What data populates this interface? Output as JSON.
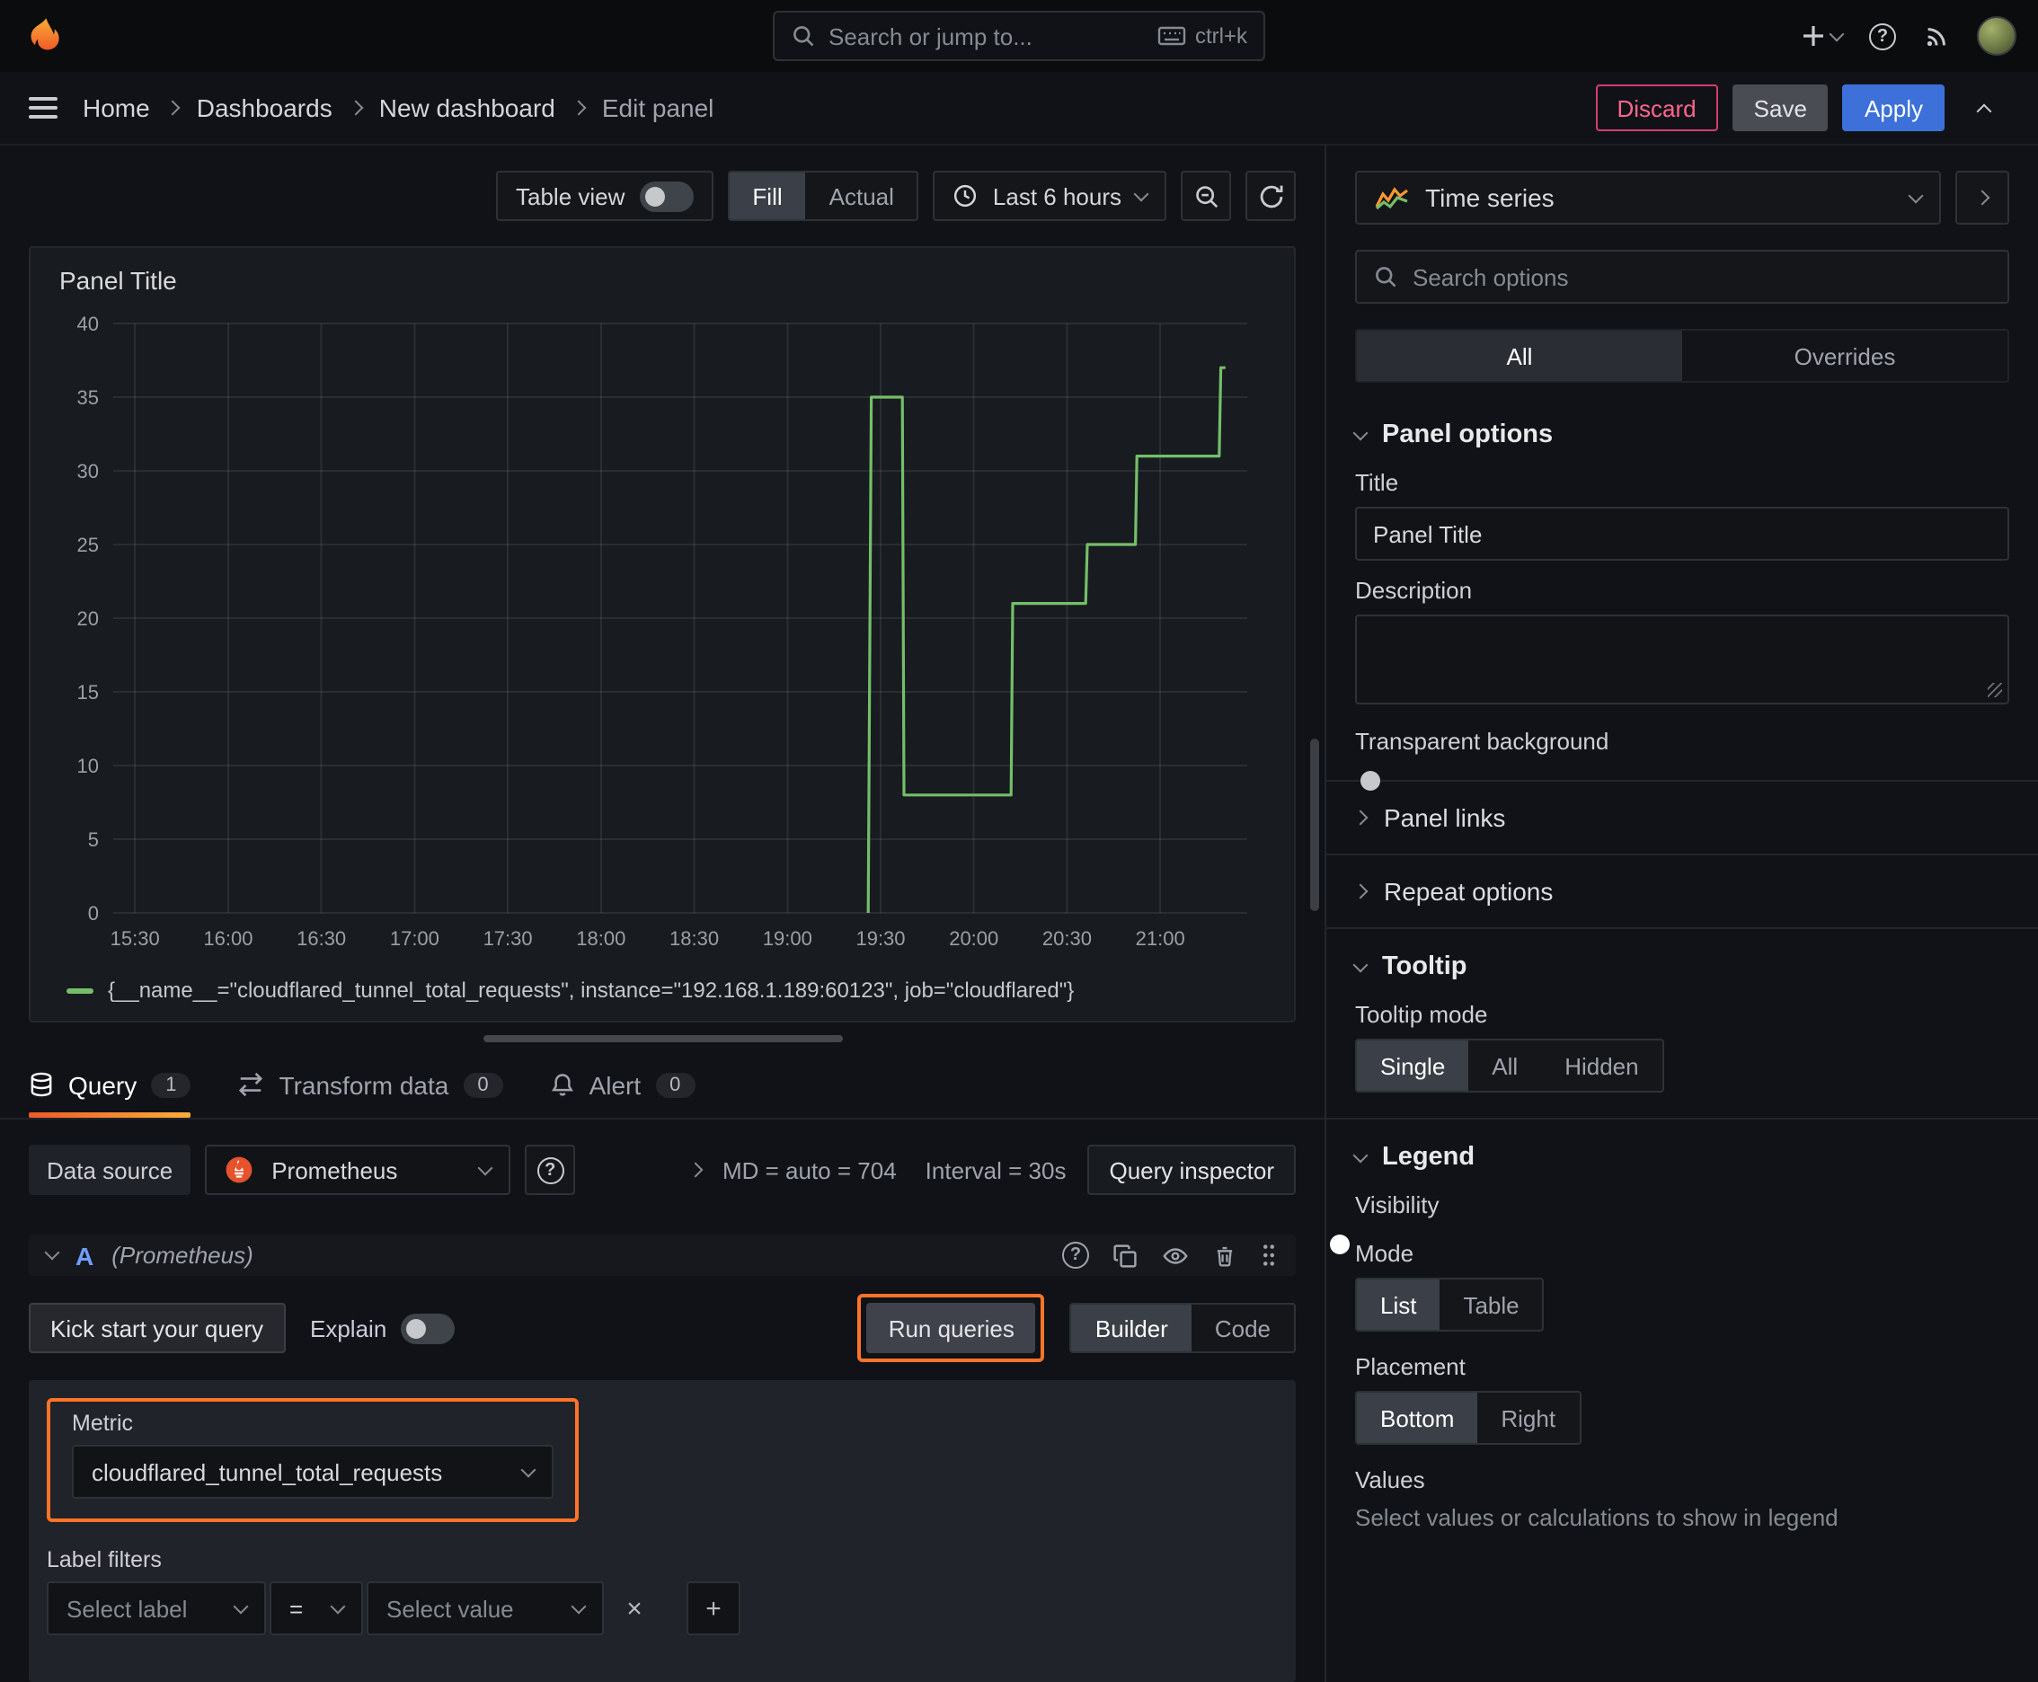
{
  "topnav": {
    "search_placeholder": "Search or jump to...",
    "shortcut": "ctrl+k"
  },
  "breadcrumb": {
    "items": [
      "Home",
      "Dashboards",
      "New dashboard",
      "Edit panel"
    ],
    "discard_label": "Discard",
    "save_label": "Save",
    "apply_label": "Apply"
  },
  "toolbar": {
    "table_view_label": "Table view",
    "fill_label": "Fill",
    "actual_label": "Actual",
    "time_range_label": "Last 6 hours"
  },
  "panel": {
    "title": "Panel Title"
  },
  "chart_data": {
    "type": "line",
    "title": "Panel Title",
    "x_unit": "minutes since 15:30",
    "x_ticks": [
      "15:30",
      "16:00",
      "16:30",
      "17:00",
      "17:30",
      "18:00",
      "18:30",
      "19:00",
      "19:30",
      "20:00",
      "20:30",
      "21:00"
    ],
    "x_tick_minutes": [
      0,
      30,
      60,
      90,
      120,
      150,
      180,
      210,
      240,
      270,
      300,
      330
    ],
    "xlim": [
      -7,
      358
    ],
    "ylim": [
      0,
      40
    ],
    "y_ticks": [
      0,
      5,
      10,
      15,
      20,
      25,
      30,
      35,
      40
    ],
    "grid": true,
    "legend_position": "bottom",
    "series": [
      {
        "name": "{__name__=\"cloudflared_tunnel_total_requests\", instance=\"192.168.1.189:60123\", job=\"cloudflared\"}",
        "color": "#73bf69",
        "points": [
          [
            236,
            0
          ],
          [
            237,
            35
          ],
          [
            247,
            35
          ],
          [
            247.5,
            8
          ],
          [
            282,
            8
          ],
          [
            282.5,
            21
          ],
          [
            306,
            21
          ],
          [
            306.5,
            25
          ],
          [
            322,
            25
          ],
          [
            322.5,
            31
          ],
          [
            349,
            31
          ],
          [
            349.5,
            37
          ],
          [
            351,
            37
          ]
        ]
      }
    ]
  },
  "tabs": [
    {
      "label": "Query",
      "badge": "1"
    },
    {
      "label": "Transform data",
      "badge": "0"
    },
    {
      "label": "Alert",
      "badge": "0"
    }
  ],
  "query": {
    "datasource_label": "Data source",
    "datasource_name": "Prometheus",
    "stats_md": "MD = auto = 704",
    "stats_interval": "Interval = 30s",
    "inspector_label": "Query inspector",
    "ref_id": "A",
    "ref_ds": "(Prometheus)",
    "kickstart_label": "Kick start your query",
    "explain_label": "Explain",
    "run_queries_label": "Run queries",
    "builder_label": "Builder",
    "code_label": "Code",
    "metric_label": "Metric",
    "metric_value": "cloudflared_tunnel_total_requests",
    "label_filters_label": "Label filters",
    "select_label_placeholder": "Select label",
    "operator_value": "=",
    "select_value_placeholder": "Select value"
  },
  "options": {
    "viz_label": "Time series",
    "search_placeholder": "Search options",
    "tab_all": "All",
    "tab_overrides": "Overrides",
    "panel_options_title": "Panel options",
    "title_label": "Title",
    "title_value": "Panel Title",
    "description_label": "Description",
    "transparent_label": "Transparent background",
    "panel_links_label": "Panel links",
    "repeat_options_label": "Repeat options",
    "tooltip_title": "Tooltip",
    "tooltip_mode_label": "Tooltip mode",
    "tooltip_modes": [
      "Single",
      "All",
      "Hidden"
    ],
    "legend_title": "Legend",
    "visibility_label": "Visibility",
    "mode_label": "Mode",
    "modes": [
      "List",
      "Table"
    ],
    "placement_label": "Placement",
    "placements": [
      "Bottom",
      "Right"
    ],
    "values_label": "Values",
    "values_desc": "Select values or calculations to show in legend"
  }
}
